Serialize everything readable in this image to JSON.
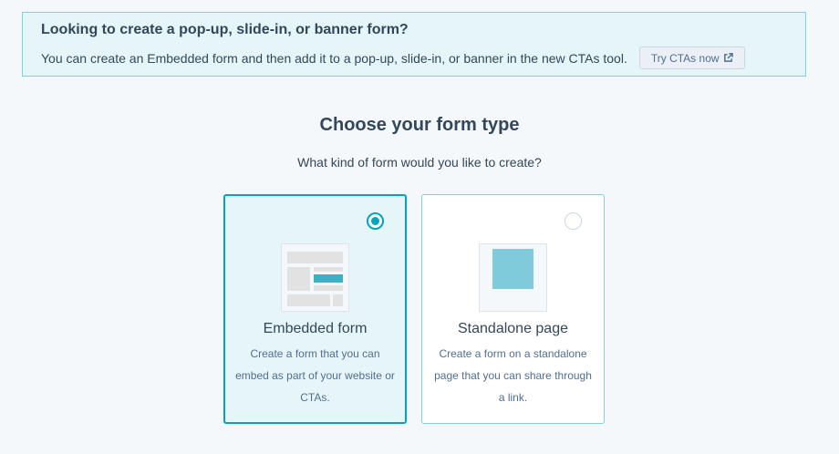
{
  "banner": {
    "title": "Looking to create a pop-up, slide-in, or banner form?",
    "text": "You can create an Embedded form and then add it to a pop-up, slide-in, or banner in the new CTAs tool.",
    "button_label": "Try CTAs now",
    "button_icon": "external-link-icon"
  },
  "heading": "Choose your form type",
  "subheading": "What kind of form would you like to create?",
  "form_types": [
    {
      "title": "Embedded form",
      "description": "Create a form that you can embed as part of your website or CTAs.",
      "selected": true
    },
    {
      "title": "Standalone page",
      "description": "Create a form on a standalone page that you can share through a link.",
      "selected": false
    }
  ],
  "colors": {
    "accent": "#00a4bd",
    "banner_bg": "#e5f5f8",
    "text": "#33475b"
  }
}
